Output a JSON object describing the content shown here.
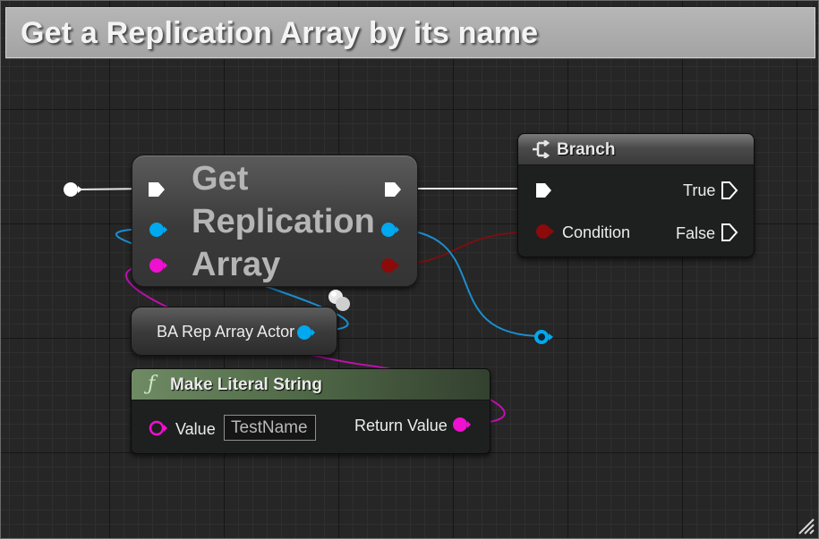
{
  "comment": {
    "title": "Get a Replication Array by its name"
  },
  "nodes": {
    "get_replication_array": {
      "title": "Get\nReplication\nArray"
    },
    "branch": {
      "title": "Branch",
      "inputs": {
        "condition": "Condition"
      },
      "outputs": {
        "true": "True",
        "false": "False"
      }
    },
    "ba_rep_array_actor": {
      "label": "BA Rep Array Actor"
    },
    "make_literal_string": {
      "title": "Make Literal String",
      "value_label": "Value",
      "value": "TestName",
      "return_label": "Return Value"
    }
  },
  "colors": {
    "exec": "#ffffff",
    "object_pin": "#00a8f0",
    "string_pin": "#f010d0",
    "bool_pin": "#8c0a0a",
    "function_header": "#4e6746"
  },
  "icons": [
    "branch-icon",
    "function-icon",
    "resize-grip-icon"
  ]
}
